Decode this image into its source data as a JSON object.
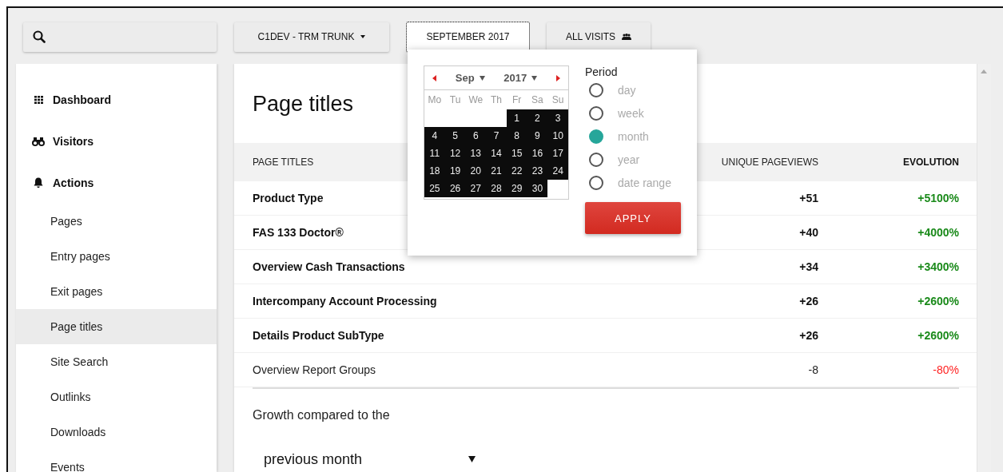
{
  "topbar": {
    "site_selector": {
      "label": "C1DEV - TRM TRUNK"
    },
    "date_button": {
      "label": "SEPTEMBER 2017",
      "focused": true
    },
    "segment_button": {
      "label": "ALL VISITS"
    }
  },
  "sidebar": {
    "items": [
      {
        "label": "Dashboard",
        "selected": false
      },
      {
        "label": "Visitors",
        "selected": false
      },
      {
        "label": "Actions",
        "selected": false,
        "children": [
          {
            "label": "Pages",
            "selected": false
          },
          {
            "label": "Entry pages",
            "selected": false
          },
          {
            "label": "Exit pages",
            "selected": false
          },
          {
            "label": "Page titles",
            "selected": true
          },
          {
            "label": "Site Search",
            "selected": false
          },
          {
            "label": "Outlinks",
            "selected": false
          },
          {
            "label": "Downloads",
            "selected": false
          },
          {
            "label": "Events",
            "selected": false
          }
        ]
      }
    ]
  },
  "report": {
    "title": "Page titles",
    "table": {
      "columns": [
        "PAGE TITLES",
        "UNIQUE PAGEVIEWS",
        "EVOLUTION"
      ],
      "rows": [
        {
          "title": "Product Type",
          "unique_pageviews": "+51",
          "evolution": "+5100%",
          "bold": true,
          "color": "#1a8a1a"
        },
        {
          "title": "FAS 133 Doctor®",
          "unique_pageviews": "+40",
          "evolution": "+4000%",
          "bold": true,
          "color": "#1a8a1a"
        },
        {
          "title": "Overview Cash Transactions",
          "unique_pageviews": "+34",
          "evolution": "+3400%",
          "bold": true,
          "color": "#1a8a1a"
        },
        {
          "title": "Intercompany Account Processing",
          "unique_pageviews": "+26",
          "evolution": "+2600%",
          "bold": true,
          "color": "#1a8a1a"
        },
        {
          "title": "Details Product SubType",
          "unique_pageviews": "+26",
          "evolution": "+2600%",
          "bold": true,
          "color": "#1a8a1a"
        },
        {
          "title": "Overview Report Groups",
          "unique_pageviews": "-8",
          "evolution": "-80%",
          "bold": false,
          "color": "#ff2222"
        }
      ]
    },
    "growth_label": "Growth compared to the",
    "comparison_select": {
      "value": "previous month"
    }
  },
  "date_popup": {
    "calendar": {
      "month": "Sep",
      "year": "2017",
      "weekdays": [
        "Mo",
        "Tu",
        "We",
        "Th",
        "Fr",
        "Sa",
        "Su"
      ],
      "cells": [
        {
          "kind": "blank"
        },
        {
          "kind": "blank"
        },
        {
          "kind": "blank"
        },
        {
          "kind": "blank"
        },
        {
          "kind": "day",
          "label": "1",
          "selected": true
        },
        {
          "kind": "day",
          "label": "2",
          "selected": true
        },
        {
          "kind": "day",
          "label": "3",
          "selected": true
        },
        {
          "kind": "day",
          "label": "4",
          "selected": true
        },
        {
          "kind": "day",
          "label": "5",
          "selected": true
        },
        {
          "kind": "day",
          "label": "6",
          "selected": true
        },
        {
          "kind": "day",
          "label": "7",
          "selected": true
        },
        {
          "kind": "day",
          "label": "8",
          "selected": true
        },
        {
          "kind": "day",
          "label": "9",
          "selected": true
        },
        {
          "kind": "day",
          "label": "10",
          "selected": true
        },
        {
          "kind": "day",
          "label": "11",
          "selected": true
        },
        {
          "kind": "day",
          "label": "12",
          "selected": true
        },
        {
          "kind": "day",
          "label": "13",
          "selected": true
        },
        {
          "kind": "day",
          "label": "14",
          "selected": true
        },
        {
          "kind": "day",
          "label": "15",
          "selected": true
        },
        {
          "kind": "day",
          "label": "16",
          "selected": true
        },
        {
          "kind": "day",
          "label": "17",
          "selected": true
        },
        {
          "kind": "day",
          "label": "18",
          "selected": true
        },
        {
          "kind": "day",
          "label": "19",
          "selected": true
        },
        {
          "kind": "day",
          "label": "20",
          "selected": true
        },
        {
          "kind": "day",
          "label": "21",
          "selected": true
        },
        {
          "kind": "day",
          "label": "22",
          "selected": true
        },
        {
          "kind": "day",
          "label": "23",
          "selected": true
        },
        {
          "kind": "day",
          "label": "24",
          "selected": true
        },
        {
          "kind": "day",
          "label": "25",
          "selected": true
        },
        {
          "kind": "day",
          "label": "26",
          "selected": true
        },
        {
          "kind": "day",
          "label": "27",
          "selected": true
        },
        {
          "kind": "day",
          "label": "28",
          "selected": true
        },
        {
          "kind": "day",
          "label": "29",
          "selected": true
        },
        {
          "kind": "day",
          "label": "30",
          "selected": true
        },
        {
          "kind": "blank"
        }
      ]
    },
    "period_label": "Period",
    "periods": [
      {
        "label": "day",
        "selected": false
      },
      {
        "label": "week",
        "selected": false
      },
      {
        "label": "month",
        "selected": true
      },
      {
        "label": "year",
        "selected": false
      },
      {
        "label": "date range",
        "selected": false
      }
    ],
    "apply_button": "APPLY"
  }
}
